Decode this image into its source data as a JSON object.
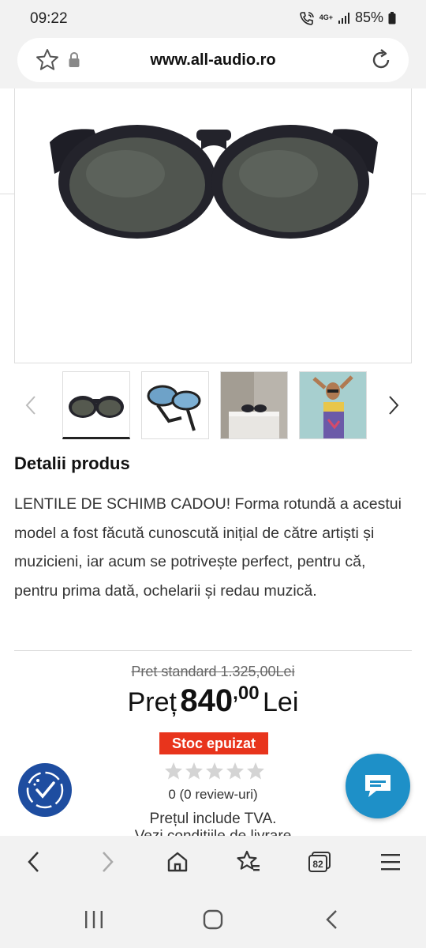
{
  "status_bar": {
    "time": "09:22",
    "network": "4G+",
    "battery": "85%",
    "icons": [
      "call-wifi-icon",
      "network-4g-icon",
      "signal-icon",
      "battery-icon"
    ]
  },
  "browser": {
    "url": "www.all-audio.ro",
    "icons": [
      "star-icon",
      "lock-icon",
      "reload-icon"
    ]
  },
  "gallery": {
    "main_image": "round-sunglasses-front",
    "thumbnails": [
      "sunglasses-front",
      "sunglasses-folded-side",
      "sunglasses-on-pedestal",
      "woman-wearing-sunglasses"
    ],
    "active_index": 0
  },
  "product": {
    "section_title": "Detalii produs",
    "description": "LENTILE DE SCHIMB CADOU! Forma rotundă a acestui model a fost făcută cunoscută inițial de către artiști și muzicieni, iar acum se potrivește perfect, pentru că, pentru prima dată, ochelarii și redau muzică.",
    "old_price": "Pret standard 1.325,00Lei",
    "price_label": "Preț",
    "price_int": "840",
    "price_dec": ",00",
    "currency": "Lei",
    "stock": "Stoc epuizat",
    "rating": 0,
    "rating_max": 5,
    "reviews": "0 (0 review-uri)",
    "tva": "Prețul include TVA.",
    "delivery": "Vezi condițiile de livrare"
  },
  "colors": {
    "stock_badge": "#e8341c",
    "fab_left": "#1e4da0",
    "fab_right": "#1e90c8"
  },
  "toolbar": {
    "items": [
      "back-icon",
      "forward-icon",
      "home-icon",
      "bookmarks-icon",
      "tabs-icon",
      "menu-icon"
    ],
    "tab_count": "82"
  },
  "navbar": {
    "items": [
      "recents-icon",
      "home-icon",
      "back-icon"
    ]
  }
}
